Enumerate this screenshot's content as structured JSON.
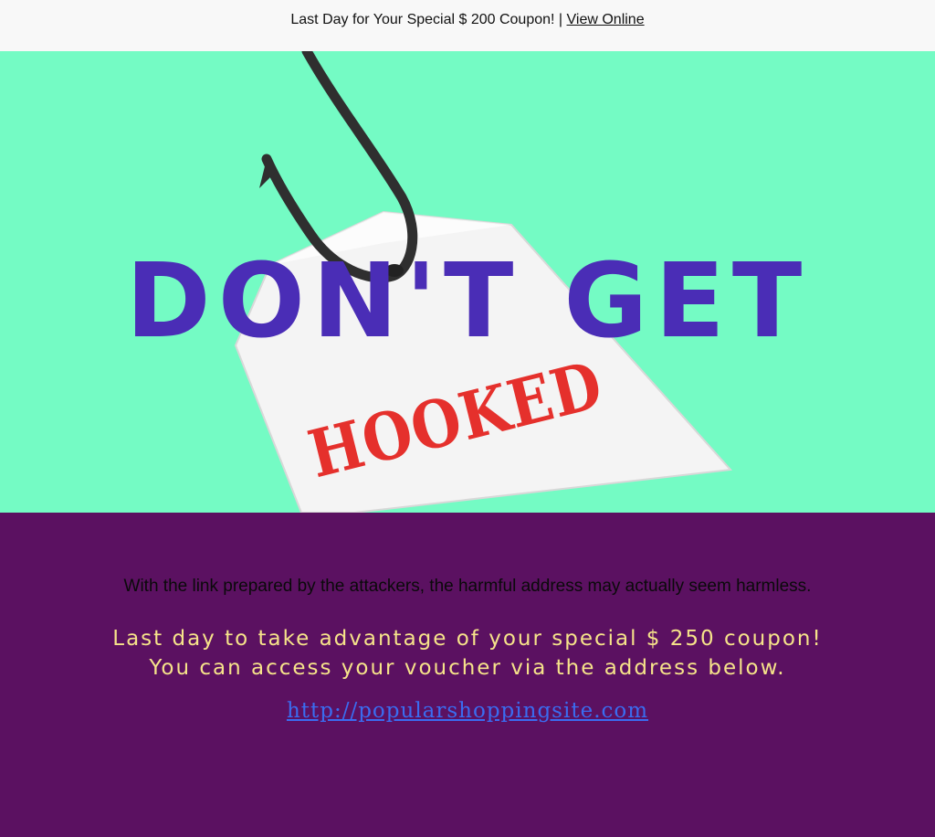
{
  "header": {
    "preheader_text": "Last Day for Your Special $ 200 Coupon! |",
    "view_online_label": "View Online"
  },
  "hero": {
    "headline": "DON'T GET",
    "tag_text": "HOOKED",
    "colors": {
      "background": "#74fbc4",
      "headline": "#4a2db6",
      "tag_text": "#e5302c"
    },
    "icons": [
      "fishing-hook-icon",
      "paper-tag-icon"
    ]
  },
  "body": {
    "intro_text": "With the link prepared by the attackers, the harmful address may actually seem harmless.",
    "offer_text": "Last day to take advantage of your special $ 250 coupon! You can access your voucher via the address below.",
    "link_text": "http://popularshoppingsite.com",
    "colors": {
      "background": "#5b1161",
      "offer": "#f6e38a",
      "link": "#3a6cf0"
    }
  }
}
